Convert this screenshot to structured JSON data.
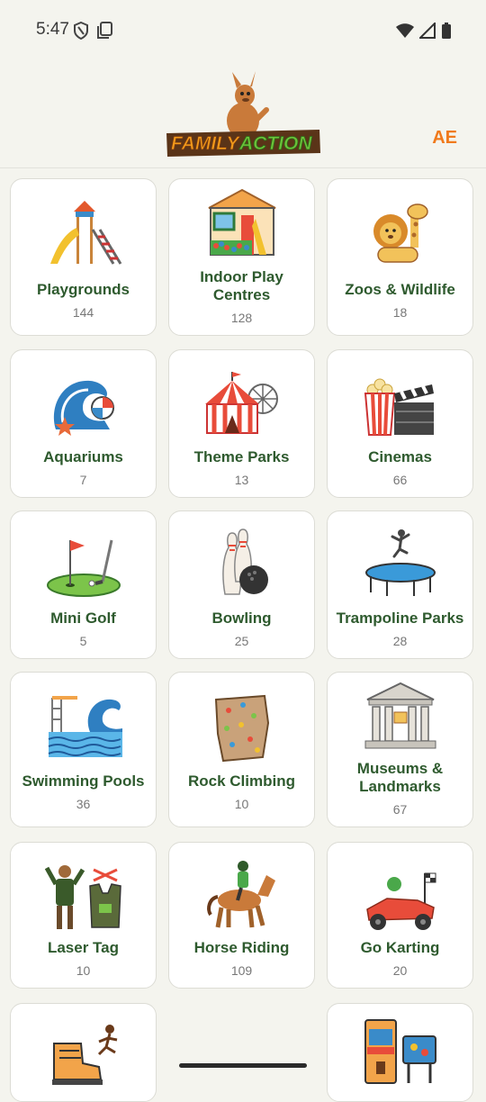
{
  "status_bar": {
    "time": "5:47"
  },
  "header": {
    "logo_text": "FAMILY ACTION",
    "lang_label": "AE"
  },
  "categories": [
    {
      "title": "Playgrounds",
      "count": "144",
      "icon": "playground-icon"
    },
    {
      "title": "Indoor Play Centres",
      "count": "128",
      "icon": "indoor-play-icon"
    },
    {
      "title": "Zoos & Wildlife",
      "count": "18",
      "icon": "zoo-icon"
    },
    {
      "title": "Aquariums",
      "count": "7",
      "icon": "wave-icon"
    },
    {
      "title": "Theme Parks",
      "count": "13",
      "icon": "circus-tent-icon"
    },
    {
      "title": "Cinemas",
      "count": "66",
      "icon": "popcorn-clapper-icon"
    },
    {
      "title": "Mini Golf",
      "count": "5",
      "icon": "golf-flag-icon"
    },
    {
      "title": "Bowling",
      "count": "25",
      "icon": "bowling-icon"
    },
    {
      "title": "Trampoline Parks",
      "count": "28",
      "icon": "trampoline-icon"
    },
    {
      "title": "Swimming Pools",
      "count": "36",
      "icon": "pool-icon"
    },
    {
      "title": "Rock Climbing",
      "count": "10",
      "icon": "climbing-wall-icon"
    },
    {
      "title": "Museums & Landmarks",
      "count": "67",
      "icon": "museum-icon"
    },
    {
      "title": "Laser Tag",
      "count": "10",
      "icon": "laser-tag-icon"
    },
    {
      "title": "Horse Riding",
      "count": "109",
      "icon": "horse-icon"
    },
    {
      "title": "Go Karting",
      "count": "20",
      "icon": "go-kart-icon"
    },
    {
      "title": "",
      "count": "",
      "icon": "roller-skate-icon"
    },
    {
      "title": "",
      "count": "",
      "icon": "arcade-icon"
    }
  ]
}
